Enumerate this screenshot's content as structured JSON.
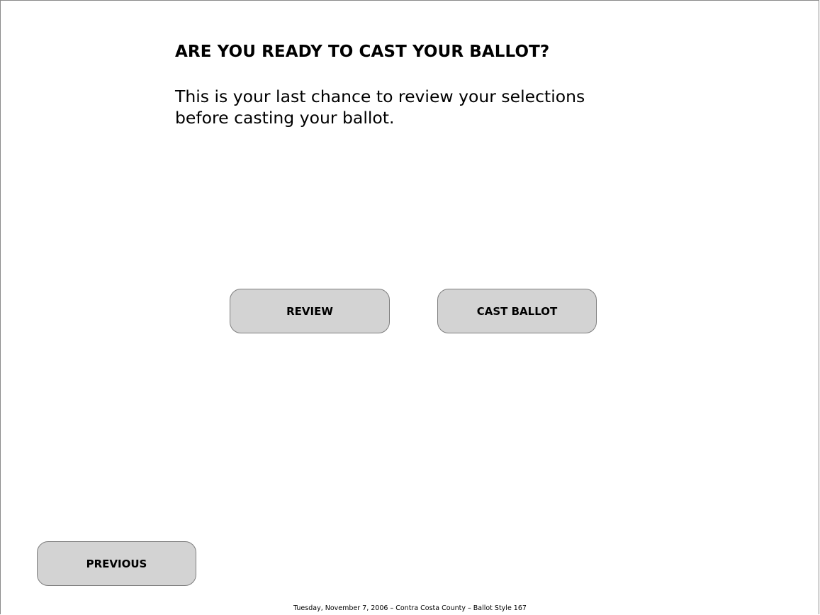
{
  "screen": {
    "heading": "ARE YOU READY TO CAST YOUR BALLOT?",
    "message": "This is your last chance to review your selections before casting your ballot."
  },
  "buttons": {
    "review_label": "REVIEW",
    "cast_ballot_label": "CAST BALLOT",
    "previous_label": "PREVIOUS"
  },
  "footer": {
    "text": "Tuesday, November 7, 2006 – Contra Costa County – Ballot Style 167"
  },
  "colors": {
    "button_background": "#d3d3d3",
    "button_border": "#7e7e7e",
    "page_background": "#ffffff"
  }
}
